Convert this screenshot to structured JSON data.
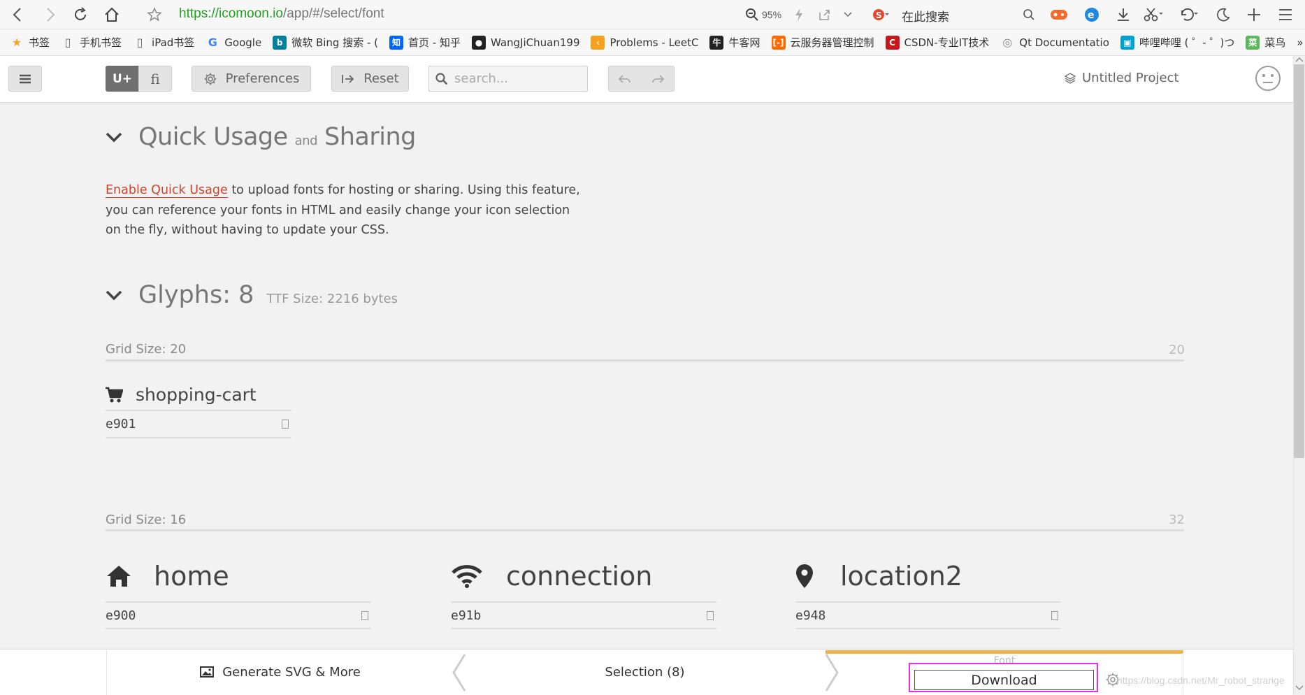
{
  "browser": {
    "url_scheme_host": "https://icomoon.io",
    "url_path": "/app/#/select/font",
    "zoom": "95%",
    "search_placeholder": "在此搜索",
    "bookmarks": [
      {
        "label": "书签",
        "icon": "star-icon",
        "color": "#f5a623"
      },
      {
        "label": "手机书签",
        "icon": "phone-icon",
        "color": "#666666"
      },
      {
        "label": "iPad书签",
        "icon": "tablet-icon",
        "color": "#666666"
      },
      {
        "label": "Google",
        "icon": "google-icon",
        "color": "#4285f4"
      },
      {
        "label": "微软 Bing 搜索 - (",
        "icon": "bing-icon",
        "color": "#00809d"
      },
      {
        "label": "首页 - 知乎",
        "icon": "zhihu-icon",
        "color": "#0066ff"
      },
      {
        "label": "WangJiChuan199",
        "icon": "github-icon",
        "color": "#222222"
      },
      {
        "label": "Problems - LeetC",
        "icon": "leetcode-icon",
        "color": "#f89f1b"
      },
      {
        "label": "牛客网",
        "icon": "nowcoder-icon",
        "color": "#222222"
      },
      {
        "label": "云服务器管理控制",
        "icon": "aliyun-icon",
        "color": "#ff6a00"
      },
      {
        "label": "CSDN-专业IT技术",
        "icon": "csdn-icon",
        "color": "#c9171e"
      },
      {
        "label": "Qt Documentatio",
        "icon": "globe-icon",
        "color": "#888888"
      },
      {
        "label": "哔哩哔哩 ( ゜- ゜)つ",
        "icon": "bilibili-icon",
        "color": "#00a1d6"
      },
      {
        "label": "菜鸟",
        "icon": "runoob-icon",
        "color": "#5cb85c"
      }
    ]
  },
  "toolbar": {
    "unicode_label": "U+",
    "ligature_label": "ﬁ",
    "preferences_label": "Preferences",
    "reset_label": "Reset",
    "search_placeholder": "search...",
    "project_name": "Untitled Project"
  },
  "quick_usage": {
    "title_a": "Quick Usage",
    "title_and": "and",
    "title_b": "Sharing",
    "link_text": "Enable Quick Usage",
    "desc_rest": " to upload fonts for hosting or sharing. Using this feature, you can reference your fonts in HTML and easily change your icon selection on the fly, without having to update your CSS."
  },
  "glyphs": {
    "title": "Glyphs: 8",
    "ttf_size": "TTF Size: 2216 bytes"
  },
  "grids": [
    {
      "label": "Grid Size: 20",
      "number": "20"
    },
    {
      "label": "Grid Size: 16",
      "number": "32"
    }
  ],
  "icons": [
    {
      "name": "shopping-cart",
      "code": "e901",
      "icon": "cart-icon"
    },
    {
      "name": "home",
      "code": "e900",
      "icon": "home-icon"
    },
    {
      "name": "connection",
      "code": "e91b",
      "icon": "wifi-icon"
    },
    {
      "name": "location2",
      "code": "e948",
      "icon": "location-icon"
    }
  ],
  "bottom": {
    "generate_label": "Generate SVG & More",
    "selection_label": "Selection (8)",
    "font_label": "Font",
    "download_label": "Download",
    "highlight_color": "#e62ee6",
    "accent_color": "#f2b24a",
    "watermark": "https://blog.csdn.net/Mr_robot_strange"
  }
}
